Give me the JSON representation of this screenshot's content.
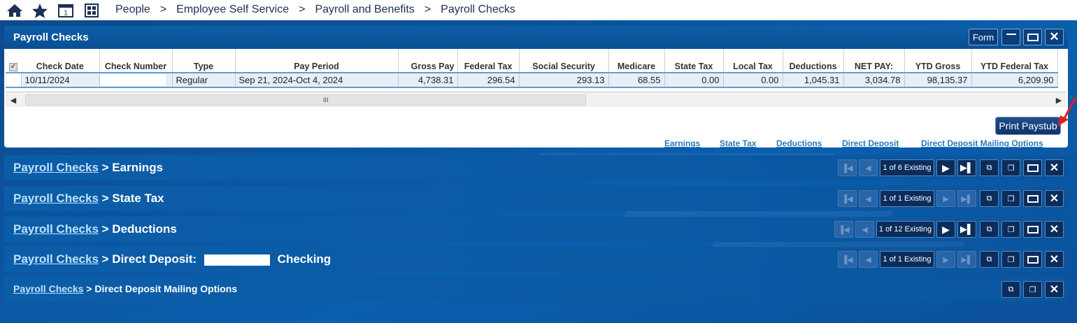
{
  "breadcrumb": [
    "People",
    "Employee Self Service",
    "Payroll and Benefits",
    "Payroll Checks"
  ],
  "panel": {
    "title": "Payroll Checks",
    "form_label": "Form",
    "columns": [
      "Check Date",
      "Check Number",
      "Type",
      "Pay Period",
      "Gross Pay",
      "Federal Tax",
      "Social Security",
      "Medicare",
      "State Tax",
      "Local Tax",
      "Deductions",
      "NET PAY:",
      "YTD Gross",
      "YTD Federal Tax"
    ],
    "row": {
      "check_date": "10/11/2024",
      "check_number": "",
      "type": "Regular",
      "pay_period": "Sep 21, 2024-Oct 4, 2024",
      "gross_pay": "4,738.31",
      "federal_tax": "296.54",
      "social_security": "293.13",
      "medicare": "68.55",
      "state_tax": "0.00",
      "local_tax": "0.00",
      "deductions": "1,045.31",
      "net_pay": "3,034.78",
      "ytd_gross": "98,135.37",
      "ytd_federal_tax": "6,209.90"
    },
    "scroll_grip": "III",
    "print_button": "Print Paystub",
    "links": [
      "Earnings",
      "State Tax",
      "Deductions",
      "Direct Deposit",
      "Direct Deposit Mailing Options"
    ]
  },
  "subpanels": [
    {
      "parent": "Payroll Checks",
      "name": "> Earnings",
      "suffix": "",
      "count": "1 of 6 Existing"
    },
    {
      "parent": "Payroll Checks",
      "name": "> State Tax",
      "suffix": "",
      "count": "1 of 1 Existing"
    },
    {
      "parent": "Payroll Checks",
      "name": "> Deductions",
      "suffix": "",
      "count": "1 of 12 Existing"
    },
    {
      "parent": "Payroll Checks",
      "name": "> Direct Deposit:",
      "suffix": "Checking",
      "count": "1 of 1 Existing"
    },
    {
      "parent": "Payroll Checks",
      "name": "> Direct Deposit Mailing Options",
      "suffix": "",
      "count": ""
    }
  ],
  "icons": {
    "home": "home-icon",
    "favorites": "star-icon",
    "calendar": "calendar-icon",
    "grid": "grid-icon",
    "minimize": "minimize-icon",
    "maximize": "maximize-icon",
    "close": "close-icon"
  },
  "colors": {
    "nav_text": "#1c2f57",
    "panel_blue": "#0a5aa6",
    "link": "#2a79b8",
    "arrow": "#e02020"
  }
}
